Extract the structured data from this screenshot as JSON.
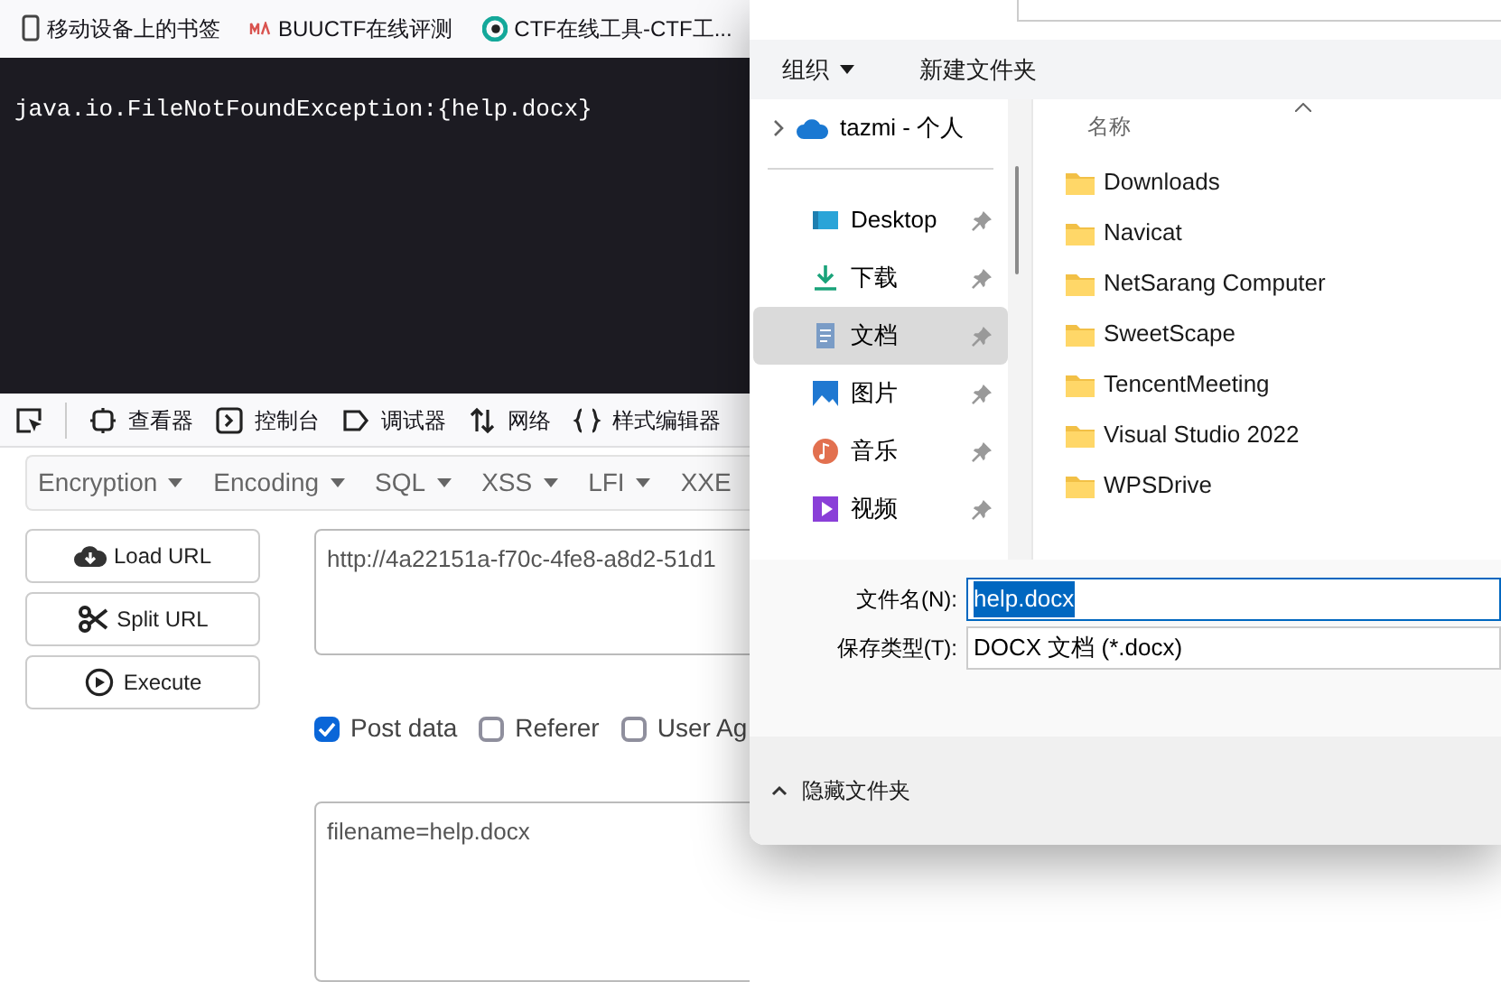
{
  "bookmarks": [
    {
      "label": "移动设备上的书签"
    },
    {
      "label": "BUUCTF在线评测"
    },
    {
      "label": "CTF在线工具-CTF工..."
    }
  ],
  "page_output": "java.io.FileNotFoundException:{help.docx}",
  "devtools_tabs": [
    {
      "label": "查看器"
    },
    {
      "label": "控制台"
    },
    {
      "label": "调试器"
    },
    {
      "label": "网络"
    },
    {
      "label": "样式编辑器"
    }
  ],
  "hackbar_menu": [
    "Encryption",
    "Encoding",
    "SQL",
    "XSS",
    "LFI",
    "XXE"
  ],
  "hackbar_buttons": [
    "Load URL",
    "Split URL",
    "Execute"
  ],
  "url_value": "http://4a22151a-f70c-4fe8-a8d2-51d1",
  "options": [
    {
      "label": "Post data",
      "checked": true
    },
    {
      "label": "Referer",
      "checked": false
    },
    {
      "label": "User Ag",
      "checked": false
    }
  ],
  "post_value": "filename=help.docx",
  "dialog": {
    "toolbar": [
      {
        "label": "组织",
        "dropdown": true
      },
      {
        "label": "新建文件夹",
        "dropdown": false
      }
    ],
    "nav_top": {
      "label": "tazmi - 个人",
      "expanded": false
    },
    "nav_items": [
      {
        "label": "Desktop",
        "selected": false
      },
      {
        "label": "下载",
        "selected": false
      },
      {
        "label": "文档",
        "selected": true
      },
      {
        "label": "图片",
        "selected": false
      },
      {
        "label": "音乐",
        "selected": false
      },
      {
        "label": "视频",
        "selected": false
      }
    ],
    "column_header": "名称",
    "files": [
      "Downloads",
      "Navicat",
      "NetSarang Computer",
      "SweetScape",
      "TencentMeeting",
      "Visual Studio 2022",
      "WPSDrive"
    ],
    "filename_label": "文件名(N):",
    "filename_value": "help.docx",
    "type_label": "保存类型(T):",
    "type_value": "DOCX 文档 (*.docx)",
    "hide_folders": "隐藏文件夹"
  }
}
